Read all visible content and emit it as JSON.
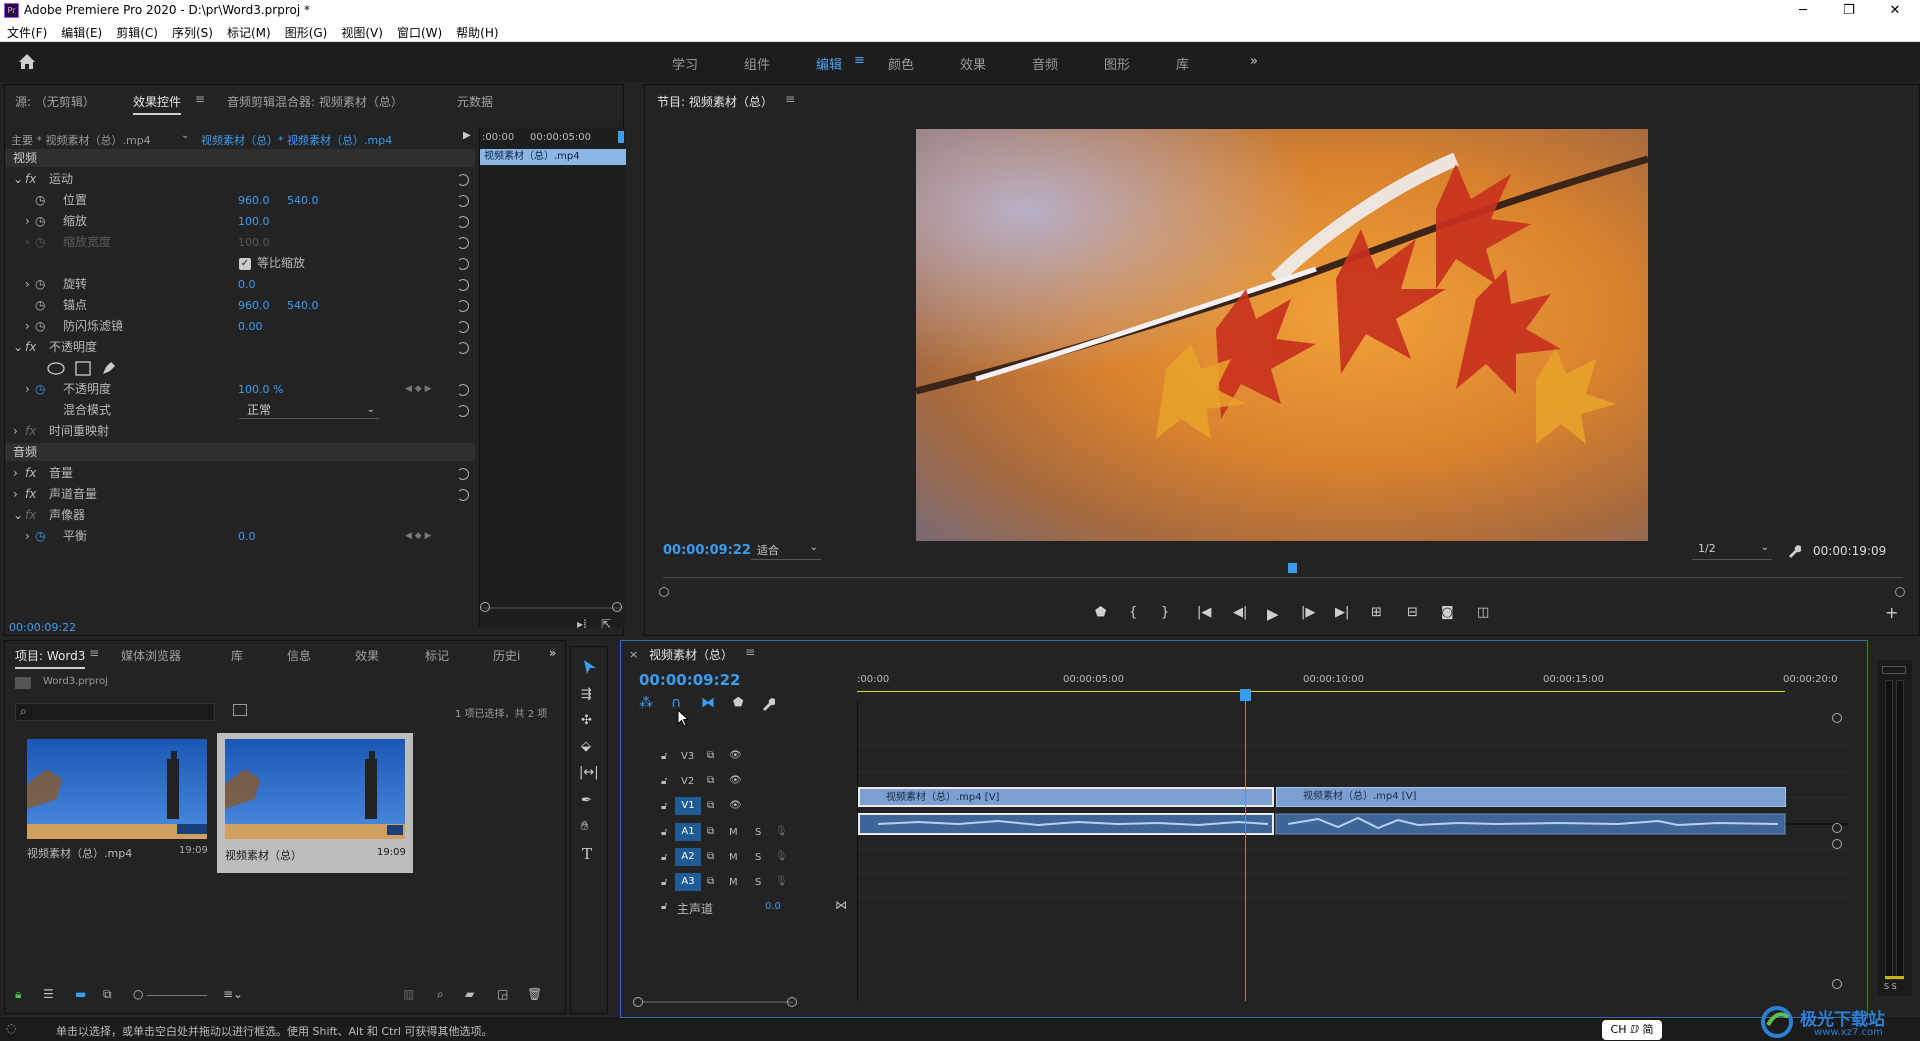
{
  "window": {
    "app_icon": "Pr",
    "title": "Adobe Premiere Pro 2020 - D:\\pr\\Word3.prproj *",
    "controls": {
      "minimize": "─",
      "maximize": "❐",
      "close": "✕"
    }
  },
  "menu": [
    "文件(F)",
    "编辑(E)",
    "剪辑(C)",
    "序列(S)",
    "标记(M)",
    "图形(G)",
    "视图(V)",
    "窗口(W)",
    "帮助(H)"
  ],
  "workspaces": {
    "items": [
      "学习",
      "组件",
      "编辑",
      "颜色",
      "效果",
      "音频",
      "图形",
      "库"
    ],
    "active": "编辑",
    "more": "»",
    "menu_glyph": "≡"
  },
  "effect_panel": {
    "tabs": [
      "源: （无剪辑）",
      "效果控件",
      "音频剪辑混合器: 视频素材（总）",
      "元数据"
    ],
    "active_tab": "效果控件",
    "menu_glyph": "≡",
    "master_label": "主要 * 视频素材（总）.mp4",
    "sequence_label": "视频素材（总）* 视频素材（总）.mp4",
    "mini_timeline": {
      "start": ":00:00",
      "end": "00:00:05:00",
      "clip": "视频素材（总）.mp4"
    },
    "sections": {
      "video": "视频",
      "audio": "音频"
    },
    "rows": {
      "motion": "运动",
      "position": {
        "label": "位置",
        "x": "960.0",
        "y": "540.0"
      },
      "scale": {
        "label": "缩放",
        "value": "100.0"
      },
      "scale_width": {
        "label": "缩放宽度",
        "value": "100.0"
      },
      "uniform_scale": "等比缩放",
      "rotation": {
        "label": "旋转",
        "value": "0.0"
      },
      "anchor": {
        "label": "锚点",
        "x": "960.0",
        "y": "540.0"
      },
      "antiflicker": {
        "label": "防闪烁滤镜",
        "value": "0.00"
      },
      "opacity_group": "不透明度",
      "opacity": {
        "label": "不透明度",
        "value": "100.0 %"
      },
      "blend_mode": {
        "label": "混合模式",
        "value": "正常"
      },
      "time_remap": "时间重映射",
      "volume": "音量",
      "channel_volume": "声道音量",
      "panner": "声像器",
      "balance": {
        "label": "平衡",
        "value": "0.0"
      }
    },
    "timecode": "00:00:09:22"
  },
  "program_monitor": {
    "title": "节目: 视频素材（总）",
    "menu_glyph": "≡",
    "timecode": "00:00:09:22",
    "fit": "适合",
    "resolution": "1/2",
    "duration": "00:00:19:09",
    "playhead_fraction": 0.5074
  },
  "project_panel": {
    "tabs": [
      "项目: Word3",
      "媒体浏览器",
      "库",
      "信息",
      "效果",
      "标记",
      "历史i"
    ],
    "active_tab": "项目: Word3",
    "menu_glyph": "≡",
    "more": "»",
    "project_file": "Word3.prproj",
    "selection_status": "1 项已选择，共 2 项",
    "items": [
      {
        "name": "视频素材（总）.mp4",
        "duration": "19:09"
      },
      {
        "name": "视频素材（总）",
        "duration": "19:09"
      }
    ]
  },
  "timeline": {
    "title": "视频素材（总）",
    "close": "×",
    "menu_glyph": "≡",
    "timecode": "00:00:09:22",
    "ruler": [
      ":00:00",
      "00:00:05:00",
      "00:00:10:00",
      "00:00:15:00",
      "00:00:20:0"
    ],
    "playhead_fraction": 0.4833,
    "tracks": {
      "video": [
        "V3",
        "V2",
        "V1"
      ],
      "audio": [
        "A1",
        "A2",
        "A3"
      ],
      "master": {
        "label": "主声道",
        "value": "0.0"
      },
      "mute": "M",
      "solo": "S"
    },
    "clips": {
      "v1_a": "视频素材（总）.mp4 [V]",
      "v1_b": "视频素材（总）.mp4 [V]"
    },
    "meter_label": "S S"
  },
  "status_bar": {
    "text": "单击以选择，或单击空白处并拖动以进行框选。使用 Shift、Alt 和 Ctrl 可获得其他选项。",
    "ime": "CH ⅅ 简",
    "watermark": "极光下载站",
    "watermark_url": "www.xz7.com"
  },
  "colors": {
    "accent": "#3a9df2",
    "panel": "#232323",
    "clip": "#7a9fd0",
    "audio_clip": "#3f6497",
    "playhead": "#3a9df2",
    "work_area": "#e8d81a"
  }
}
